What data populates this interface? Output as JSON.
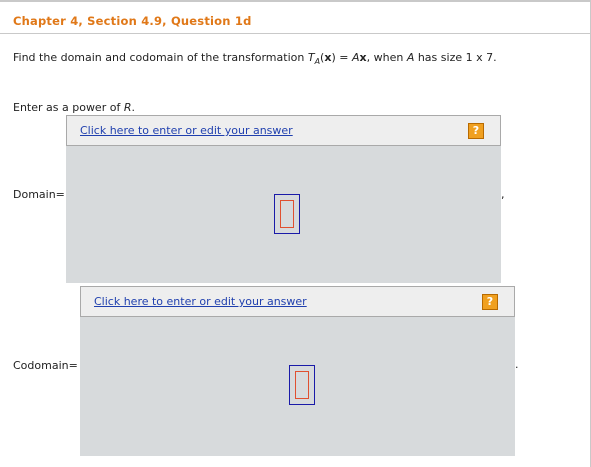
{
  "header": {
    "title": "Chapter 4, Section 4.9, Question 1d"
  },
  "question": {
    "prefix": "Find the domain and codomain of the transformation ",
    "T": "T",
    "subscript": "A",
    "paren_open": "(",
    "x": "x",
    "paren_close_eq": ") = ",
    "A": "A",
    "x2": "x",
    "middle": ", when ",
    "A2": "A",
    "suffix": " has size 1 x 7."
  },
  "instruction": {
    "prefix": "Enter as a power of ",
    "R": "R",
    "suffix": "."
  },
  "domain": {
    "label": "Domain=",
    "link_text": "Click here to enter or edit your answer",
    "help_icon": "?",
    "trailing": ","
  },
  "codomain": {
    "label": "Codomain=",
    "link_text": "Click here to enter or edit your answer",
    "help_icon": "?",
    "trailing": "."
  },
  "colors": {
    "title": "#e07818",
    "link": "#1f3fae",
    "panel": "#d7dadc",
    "help_icon": "#f0a020",
    "box_outer": "#1a1aa8",
    "box_inner": "#e05030"
  }
}
